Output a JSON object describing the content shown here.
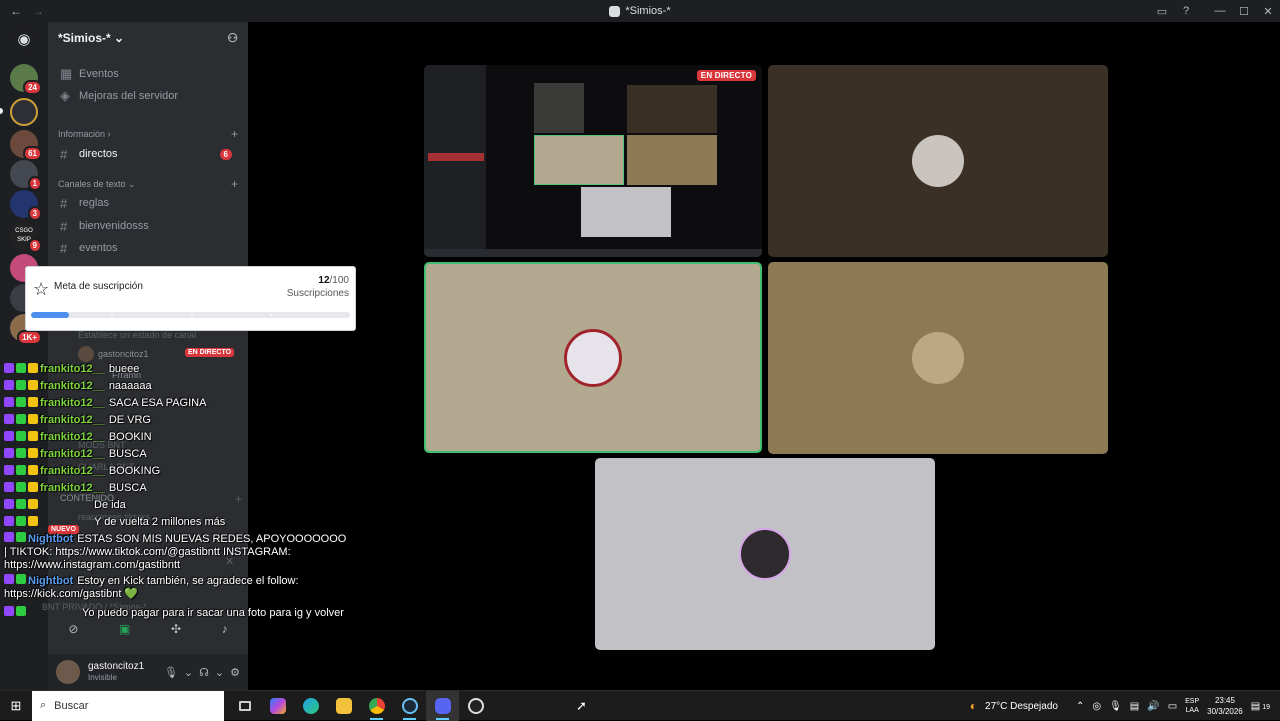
{
  "window": {
    "title": "*Simios-*",
    "back": "←",
    "forward": "→"
  },
  "rail": {
    "badges": [
      "24",
      "61",
      "1",
      "3",
      "9",
      "1K+"
    ],
    "labels": [
      "CSGO SKIP"
    ]
  },
  "server": {
    "name": "*Simios-*",
    "top_items": [
      "Eventos",
      "Mejoras del servidor"
    ],
    "category_info": "Información",
    "channel_directos": "directos",
    "directos_badge": "6",
    "category_text": "Canales de texto",
    "text_channels": [
      "reglas",
      "bienvenidosss",
      "eventos"
    ],
    "ghost_status": "Establece un estado de canal",
    "ghost_user": "gastoncitoz1",
    "ghost_live": "EN DIRECTO",
    "ghost_user2": "Frramn",
    "ghost_mods": "MODS BNT",
    "ghost_charla": "CHARLA BNT",
    "ghost_contenido": "CONTENIDO",
    "ghost_reacciones": "reacciones-tiktoks",
    "ghost_nuevo": "NUEVO",
    "ghost_pantalla": "Pantalla",
    "ghost_bnt": "BNT PRIVADO / *Simios-*"
  },
  "user": {
    "name": "gastoncitoz1",
    "status": "Invisible"
  },
  "stream": {
    "live_label": "EN DIRECTO"
  },
  "sub_goal": {
    "title": "Meta de suscripción",
    "count": "12",
    "total": "/100",
    "unit": "Suscripciones",
    "progress": 0.12
  },
  "chat": [
    {
      "user": "frankito12__",
      "text": "bueee",
      "style": "green"
    },
    {
      "user": "frankito12__",
      "text": "naaaaaa",
      "style": "green"
    },
    {
      "user": "frankito12__",
      "text": "SACA ESA PAGINA",
      "style": "green"
    },
    {
      "user": "frankito12__",
      "text": "DE VRG",
      "style": "green"
    },
    {
      "user": "frankito12__",
      "text": "BOOKIN",
      "style": "green"
    },
    {
      "user": "frankito12__",
      "text": "BUSCA",
      "style": "green"
    },
    {
      "user": "frankito12__",
      "text": "BOOKING",
      "style": "green"
    },
    {
      "user": "frankito12__",
      "text": "BUSCA",
      "style": "green"
    },
    {
      "user": "",
      "text": "De ida",
      "style": "blue"
    },
    {
      "user": "",
      "text": "Y de vuelta 2 millones más",
      "style": "blue"
    }
  ],
  "chat_long": [
    {
      "user": "Nightbot",
      "text": "ESTAS SON MIS NUEVAS REDES, APOYOOOOOOO | TIKTOK: https://www.tiktok.com/@gastibntt INSTAGRAM: https://www.instagram.com/gastibntt"
    },
    {
      "user": "Nightbot",
      "text": "Estoy en Kick también, se agradece el follow: https://kick.com/gastibnt 💚"
    },
    {
      "user": "",
      "text": "Yo puedo pagar para ir sacar una foto para ig y volver"
    }
  ],
  "taskbar": {
    "search_placeholder": "Buscar",
    "weather": "27°C  Despejado",
    "lang1": "ESP",
    "lang2": "LAA",
    "time": "23:45",
    "date": "30/3/2026",
    "notif": "19"
  }
}
